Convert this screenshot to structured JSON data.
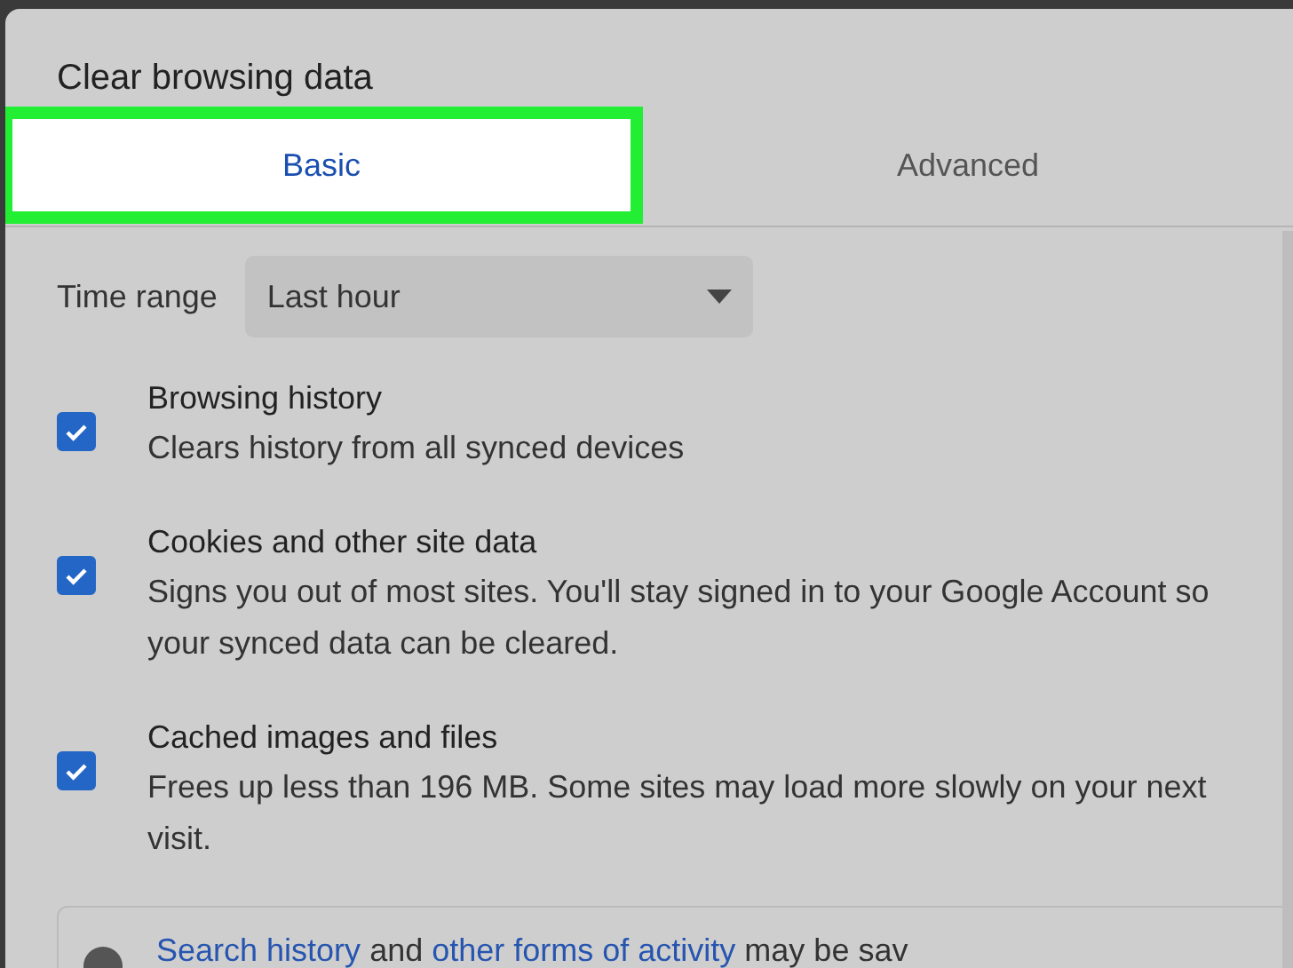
{
  "dialog": {
    "title": "Clear browsing data"
  },
  "tabs": [
    {
      "label": "Basic",
      "selected": true
    },
    {
      "label": "Advanced",
      "selected": false
    }
  ],
  "time_range": {
    "label": "Time range",
    "value": "Last hour"
  },
  "options": [
    {
      "title": "Browsing history",
      "description": "Clears history from all synced devices",
      "checked": true
    },
    {
      "title": "Cookies and other site data",
      "description": "Signs you out of most sites. You'll stay signed in to your Google Account so your synced data can be cleared.",
      "checked": true
    },
    {
      "title": "Cached images and files",
      "description": "Frees up less than 196 MB. Some sites may load more slowly on your next visit.",
      "checked": true
    }
  ],
  "notice": {
    "links": [
      "Search history",
      "other forms of activity"
    ],
    "text_1": "and",
    "text_2": "may be sav"
  }
}
